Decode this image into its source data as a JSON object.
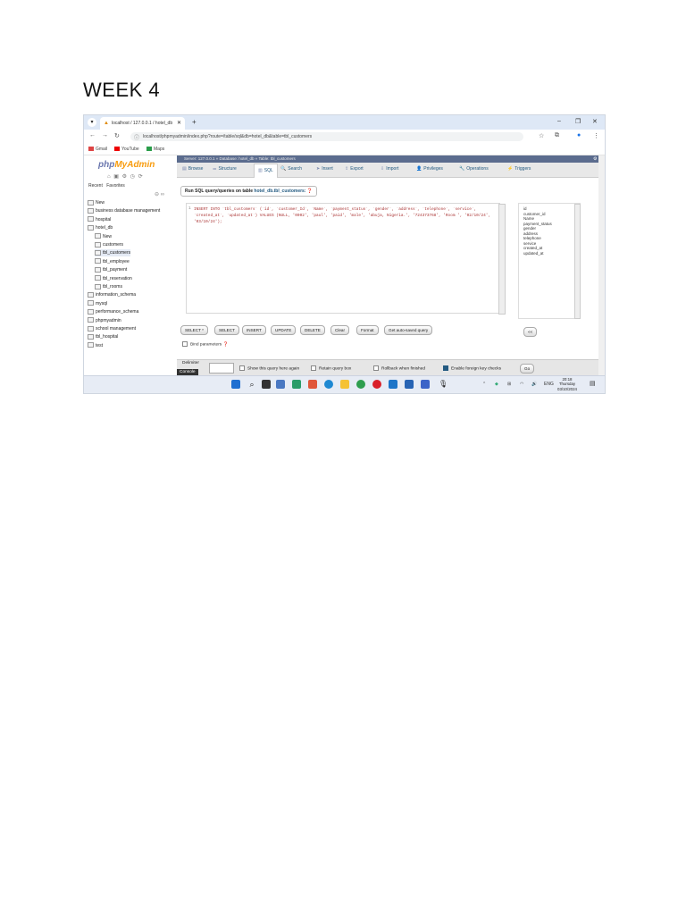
{
  "document": {
    "heading": "WEEK 4"
  },
  "browser": {
    "tab_title": "localhost / 127.0.0.1 / hotel_db",
    "new_tab": "+",
    "win_min": "–",
    "win_max": "❐",
    "win_close": "✕",
    "url": "localhost/phpmyadmin/index.php?route=/table/sql&db=hotel_db&table=tbl_customers",
    "bookmarks": [
      "Gmail",
      "YouTube",
      "Maps"
    ]
  },
  "pma": {
    "logo_php": "php",
    "logo_my": "MyAdmin",
    "recent": "Recent",
    "favorites": "Favorites",
    "tree": [
      {
        "label": "New",
        "indent": 0,
        "selected": false
      },
      {
        "label": "business database management",
        "indent": 0,
        "selected": false
      },
      {
        "label": "hospital",
        "indent": 0,
        "selected": false
      },
      {
        "label": "hotel_db",
        "indent": 0,
        "selected": false
      },
      {
        "label": "New",
        "indent": 1,
        "selected": false
      },
      {
        "label": "customers",
        "indent": 1,
        "selected": false
      },
      {
        "label": "tbl_customers",
        "indent": 1,
        "selected": true
      },
      {
        "label": "tbl_employee",
        "indent": 1,
        "selected": false
      },
      {
        "label": "tbl_payment",
        "indent": 1,
        "selected": false
      },
      {
        "label": "tbl_reservation",
        "indent": 1,
        "selected": false
      },
      {
        "label": "tbl_rooms",
        "indent": 1,
        "selected": false
      },
      {
        "label": "information_schema",
        "indent": 0,
        "selected": false
      },
      {
        "label": "mysql",
        "indent": 0,
        "selected": false
      },
      {
        "label": "performance_schema",
        "indent": 0,
        "selected": false
      },
      {
        "label": "phpmyadmin",
        "indent": 0,
        "selected": false
      },
      {
        "label": "school management",
        "indent": 0,
        "selected": false
      },
      {
        "label": "tbl_hospital",
        "indent": 0,
        "selected": false
      },
      {
        "label": "test",
        "indent": 0,
        "selected": false
      }
    ],
    "breadcrumb": "Server: 127.0.0.1 » Database: hotel_db » Table: tbl_customers",
    "tabs": [
      "Browse",
      "Structure",
      "SQL",
      "Search",
      "Insert",
      "Export",
      "Import",
      "Privileges",
      "Operations",
      "Triggers"
    ],
    "run_sql_prefix": "Run SQL query/queries on table ",
    "run_sql_table": "hotel_db.tbl_customers:",
    "sql_line_no": "1",
    "sql_query": "INSERT INTO `tbl_customers` (`id`, `customer_Id`, `Name`, `payment_status`, `gender`, `address`, `telephone`, `service`, `created_at`, `updated_at`) VALUES (NULL, '0002', 'paul', 'paid', 'male', 'abuja, Nigeria.', '724373768', 'Room ', '02/10/24', '03/10/24');",
    "columns": [
      "id",
      "customer_id",
      "Name",
      "payment_status",
      "gender",
      "address",
      "telephone",
      "service",
      "created_at",
      "updated_at"
    ],
    "buttons": [
      "SELECT *",
      "SELECT",
      "INSERT",
      "UPDATE",
      "DELETE",
      "Clear",
      "Format",
      "Get auto-saved query"
    ],
    "insert_col_button": "<<",
    "bind_params": "Bind parameters",
    "options": {
      "delimiter_label": "Delimiter",
      "show_again": "Show this query here again",
      "retain_box": "Retain query box",
      "rollback": "Rollback when finished",
      "foreign_key": "Enable foreign key checks",
      "go": "Go",
      "console": "Console"
    }
  },
  "taskbar": {
    "lang": "ENG",
    "time": "20:18",
    "day": "Thursday",
    "date": "03/10/2024"
  }
}
